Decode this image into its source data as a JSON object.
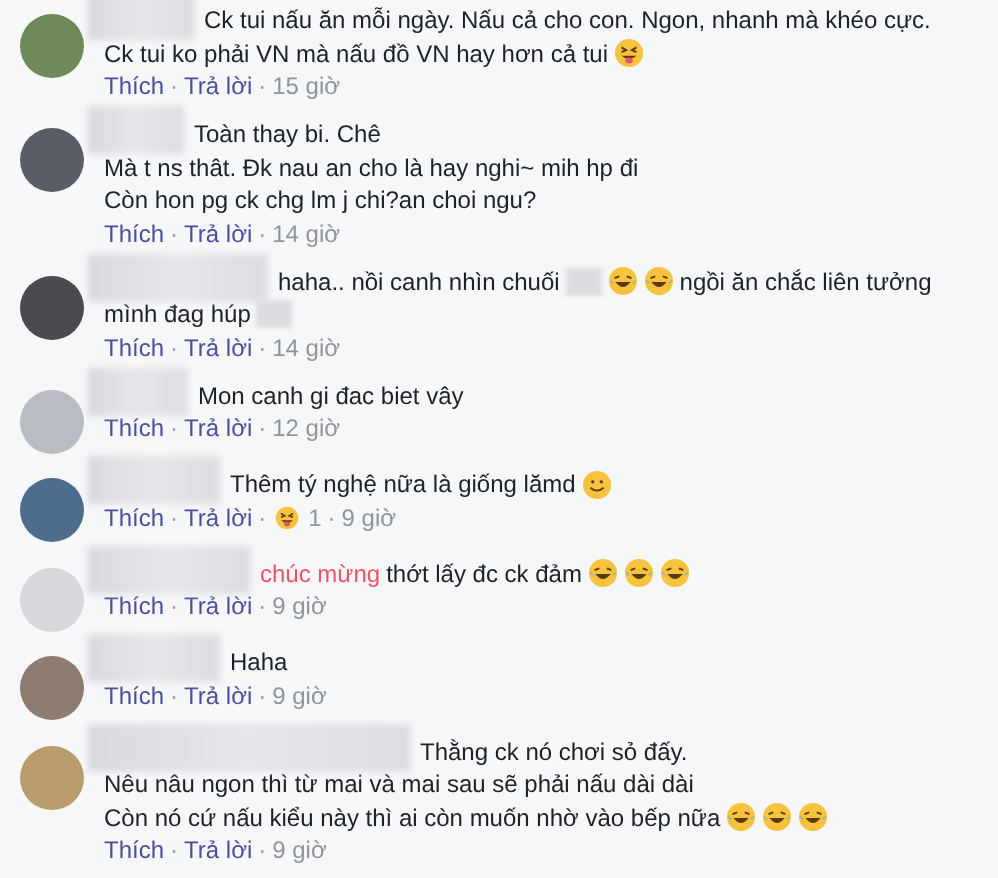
{
  "comments": [
    {
      "lines": [
        [
          {
            "kind": "text",
            "text": "Ck tui nấu ăn mỗi ngày. Nấu cả cho con. Ngon, nhanh mà khéo cực."
          }
        ],
        [
          {
            "kind": "text",
            "text": "Ck tui ko phải VN mà nấu đồ VN hay hơn cả tui"
          },
          {
            "kind": "tongue"
          }
        ]
      ],
      "meta": [
        {
          "kind": "link",
          "text": "Thích"
        },
        {
          "kind": "dot",
          "text": "·"
        },
        {
          "kind": "link",
          "text": "Trả lời"
        },
        {
          "kind": "dot",
          "text": "·"
        },
        {
          "kind": "time",
          "text": "15 giờ"
        }
      ]
    },
    {
      "lines": [
        [
          {
            "kind": "text",
            "text": "Toàn thay bi. Chê"
          }
        ],
        [
          {
            "kind": "text",
            "text": "Mà t ns thât. Đk nau an cho là hay nghi~ mih hp đi"
          }
        ],
        [
          {
            "kind": "text",
            "text": "Còn hon pg ck chg lm j chi?an choi ngu?"
          }
        ]
      ],
      "meta": [
        {
          "kind": "link",
          "text": "Thích"
        },
        {
          "kind": "dot",
          "text": "·"
        },
        {
          "kind": "link",
          "text": "Trả lời"
        },
        {
          "kind": "dot",
          "text": "·"
        },
        {
          "kind": "time",
          "text": "14 giờ"
        }
      ]
    },
    {
      "lines": [
        [
          {
            "kind": "text",
            "text": "haha.. nồi canh nhìn chuối"
          },
          {
            "kind": "blur"
          },
          {
            "kind": "laugh"
          },
          {
            "kind": "laugh"
          },
          {
            "kind": "text",
            "text": "ngồi ăn chắc liên tưởng"
          }
        ],
        [
          {
            "kind": "text",
            "text": "mình đag húp"
          },
          {
            "kind": "blur"
          }
        ]
      ],
      "meta": [
        {
          "kind": "link",
          "text": "Thích"
        },
        {
          "kind": "dot",
          "text": "·"
        },
        {
          "kind": "link",
          "text": "Trả lời"
        },
        {
          "kind": "dot",
          "text": "·"
        },
        {
          "kind": "time",
          "text": "14 giờ"
        }
      ]
    },
    {
      "lines": [
        [
          {
            "kind": "text",
            "text": "Mon canh gi đac biet vây"
          }
        ]
      ],
      "meta": [
        {
          "kind": "link",
          "text": "Thích"
        },
        {
          "kind": "dot",
          "text": "·"
        },
        {
          "kind": "link",
          "text": "Trả lời"
        },
        {
          "kind": "dot",
          "text": "·"
        },
        {
          "kind": "time",
          "text": "12 giờ"
        }
      ]
    },
    {
      "lines": [
        [
          {
            "kind": "text",
            "text": "Thêm tý nghệ nữa là giống lămd"
          },
          {
            "kind": "smile"
          }
        ]
      ],
      "meta": [
        {
          "kind": "link",
          "text": "Thích"
        },
        {
          "kind": "dot",
          "text": "·"
        },
        {
          "kind": "link",
          "text": "Trả lời"
        },
        {
          "kind": "dot",
          "text": "·"
        },
        {
          "kind": "tongue"
        },
        {
          "kind": "count",
          "text": "1"
        },
        {
          "kind": "dot",
          "text": "·"
        },
        {
          "kind": "time",
          "text": "9 giờ"
        }
      ]
    },
    {
      "lines": [
        [
          {
            "kind": "highlight",
            "text": "chúc mừng"
          },
          {
            "kind": "text",
            "text": "thớt lấy đc ck đảm"
          },
          {
            "kind": "laugh"
          },
          {
            "kind": "laugh"
          },
          {
            "kind": "laugh"
          }
        ]
      ],
      "meta": [
        {
          "kind": "link",
          "text": "Thích"
        },
        {
          "kind": "dot",
          "text": "·"
        },
        {
          "kind": "link",
          "text": "Trả lời"
        },
        {
          "kind": "dot",
          "text": "·"
        },
        {
          "kind": "time",
          "text": "9 giờ"
        }
      ]
    },
    {
      "lines": [
        [
          {
            "kind": "text",
            "text": "Haha"
          }
        ]
      ],
      "meta": [
        {
          "kind": "link",
          "text": "Thích"
        },
        {
          "kind": "dot",
          "text": "·"
        },
        {
          "kind": "link",
          "text": "Trả lời"
        },
        {
          "kind": "dot",
          "text": "·"
        },
        {
          "kind": "time",
          "text": "9 giờ"
        }
      ]
    },
    {
      "lines": [
        [
          {
            "kind": "text",
            "text": "Thằng ck nó chơi sỏ đấy."
          }
        ],
        [
          {
            "kind": "text",
            "text": "Nêu nâu ngon thì từ mai và mai sau sẽ phải nấu dài dài"
          }
        ],
        [
          {
            "kind": "text",
            "text": "Còn nó cứ nấu kiểu này thì ai còn muốn nhờ vào bếp nữa"
          },
          {
            "kind": "laugh"
          },
          {
            "kind": "laugh"
          },
          {
            "kind": "laugh"
          }
        ]
      ],
      "meta": [
        {
          "kind": "link",
          "text": "Thích"
        },
        {
          "kind": "dot",
          "text": "·"
        },
        {
          "kind": "link",
          "text": "Trả lời"
        },
        {
          "kind": "dot",
          "text": "·"
        },
        {
          "kind": "time",
          "text": "9 giờ"
        }
      ]
    }
  ]
}
